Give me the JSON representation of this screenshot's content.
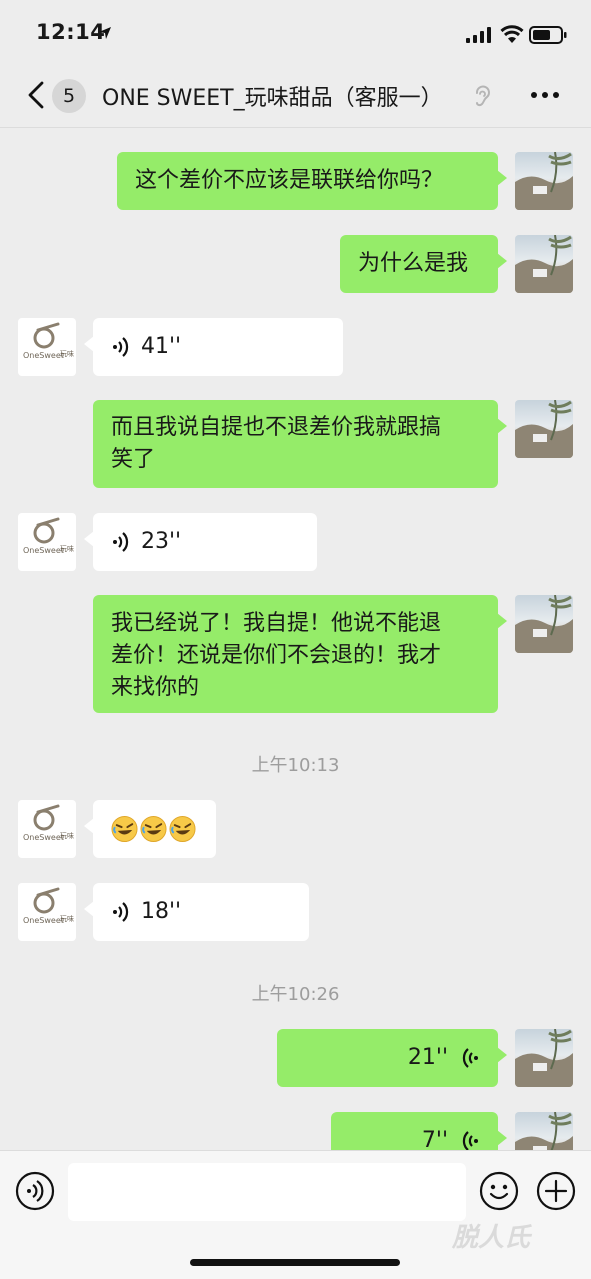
{
  "status_bar": {
    "time": "12:14"
  },
  "header": {
    "back_badge_count": "5",
    "title": "ONE SWEET_玩味甜品（客服一）"
  },
  "messages": {
    "m1": {
      "text": "这个差价不应该是联联给你吗？"
    },
    "m2": {
      "text": "为什么是我"
    },
    "m3": {
      "duration": "41''"
    },
    "m4": {
      "line1": "而且我说自提也不退差价我就跟搞",
      "line2": "笑了"
    },
    "m5": {
      "duration": "23''"
    },
    "m6": {
      "line1": "我已经说了！我自提！他说不能退",
      "line2": "差价！还说是你们不会退的！我才",
      "line3": "来找你的"
    },
    "t1": {
      "text": "上午10:13"
    },
    "m7": {
      "emoji": "rolling-on-floor-laughing"
    },
    "m8": {
      "duration": "18''"
    },
    "t2": {
      "text": "上午10:26"
    },
    "m9": {
      "duration": "21''"
    },
    "m10": {
      "duration": "7''"
    }
  },
  "avatars": {
    "logo_text": "OneSweet",
    "logo_cn": "玩味"
  },
  "input_bar": {
    "placeholder": ""
  },
  "watermark": "脱人氏",
  "colors": {
    "outgoing_bubble": "#95ec69",
    "incoming_bubble": "#ffffff",
    "background": "#ededed"
  }
}
